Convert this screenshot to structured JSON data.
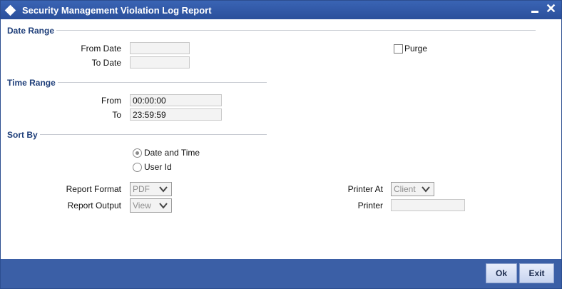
{
  "window": {
    "title": "Security Management Violation Log Report",
    "minimize_icon": "minimize-icon",
    "close_icon": "close-icon",
    "close_glyph": "✕"
  },
  "date_range": {
    "section_label": "Date Range",
    "from_label": "From Date",
    "from_value": "",
    "to_label": "To Date",
    "to_value": "",
    "purge_label": "Purge",
    "purge_checked": false
  },
  "time_range": {
    "section_label": "Time Range",
    "from_label": "From",
    "from_value": "00:00:00",
    "to_label": "To",
    "to_value": "23:59:59"
  },
  "sort_by": {
    "section_label": "Sort By",
    "options": [
      "Date and Time",
      "User Id"
    ],
    "selected": "Date and Time"
  },
  "report": {
    "format_label": "Report Format",
    "format_value": "PDF",
    "output_label": "Report Output",
    "output_value": "View",
    "printer_at_label": "Printer At",
    "printer_at_value": "Client",
    "printer_label": "Printer",
    "printer_value": ""
  },
  "footer": {
    "ok_label": "Ok",
    "exit_label": "Exit"
  },
  "colors": {
    "titlebar": "#2e54a3",
    "section_label": "#1f3f7a",
    "footer": "#3b5fa6"
  }
}
